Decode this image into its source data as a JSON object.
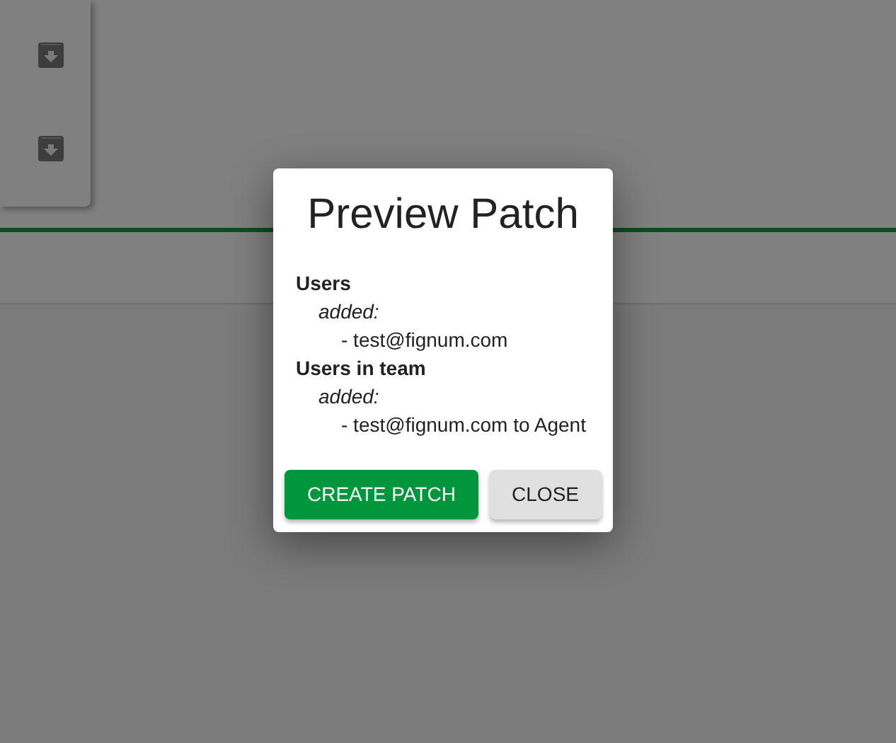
{
  "dialog": {
    "title": "Preview Patch",
    "sections": [
      {
        "title": "Users",
        "groups": [
          {
            "label": "added:",
            "entries": [
              "- test@fignum.com"
            ]
          }
        ]
      },
      {
        "title": "Users in team",
        "groups": [
          {
            "label": "added:",
            "entries": [
              "- test@fignum.com to Agent"
            ]
          }
        ]
      }
    ],
    "buttons": [
      {
        "label": "CREATE PATCH",
        "kind": "primary"
      },
      {
        "label": "CLOSE",
        "kind": "secondary"
      }
    ]
  }
}
